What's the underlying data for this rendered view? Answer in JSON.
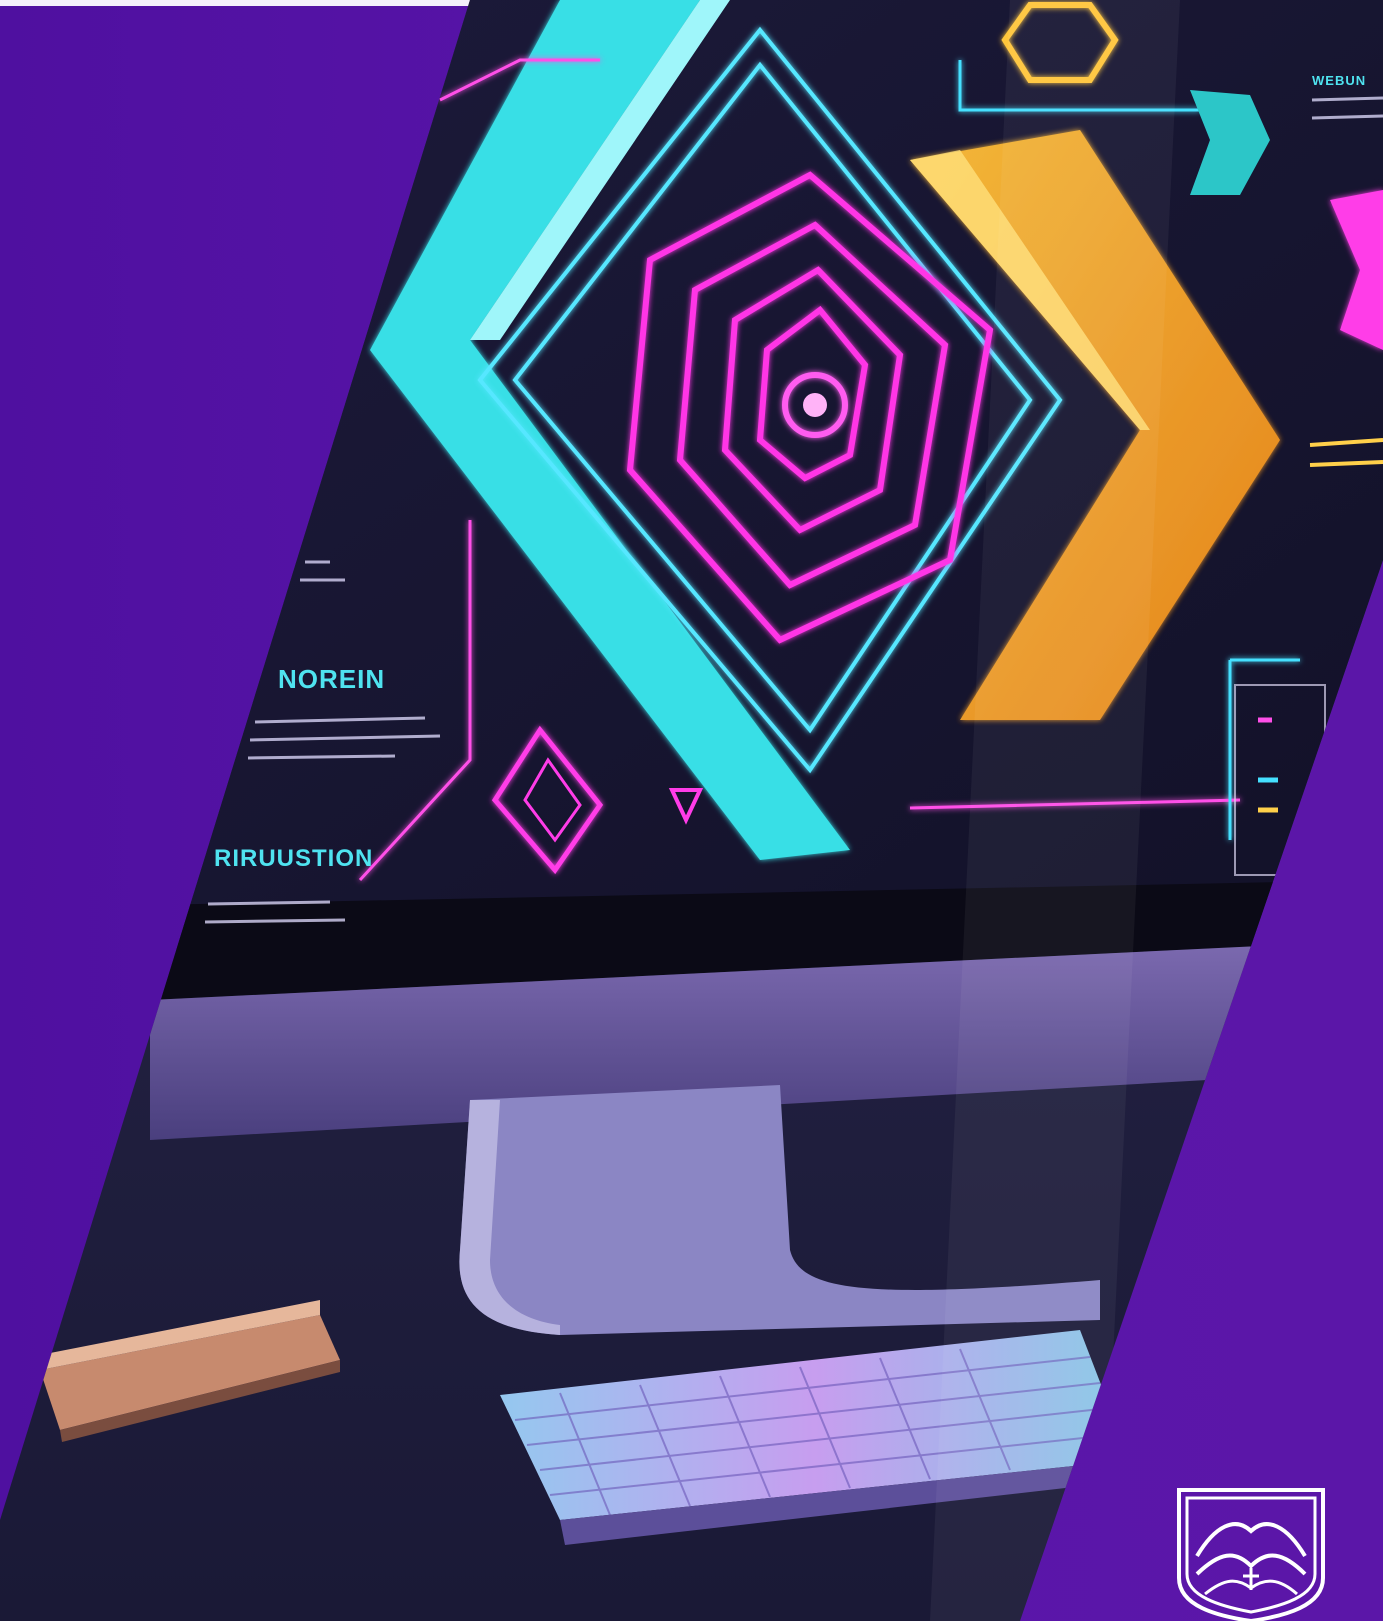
{
  "screen": {
    "heading_1": "NOREIN",
    "heading_2": "RIRUUSTION",
    "top_right_tag": "WEBUN"
  },
  "logo": {
    "icon": "crest-icon"
  },
  "colors": {
    "background_purple": "#5a15aa",
    "neon_cyan": "#3fe6ee",
    "neon_magenta": "#ff2fe0",
    "neon_orange": "#f7a623",
    "screen_dark": "#16152e"
  }
}
